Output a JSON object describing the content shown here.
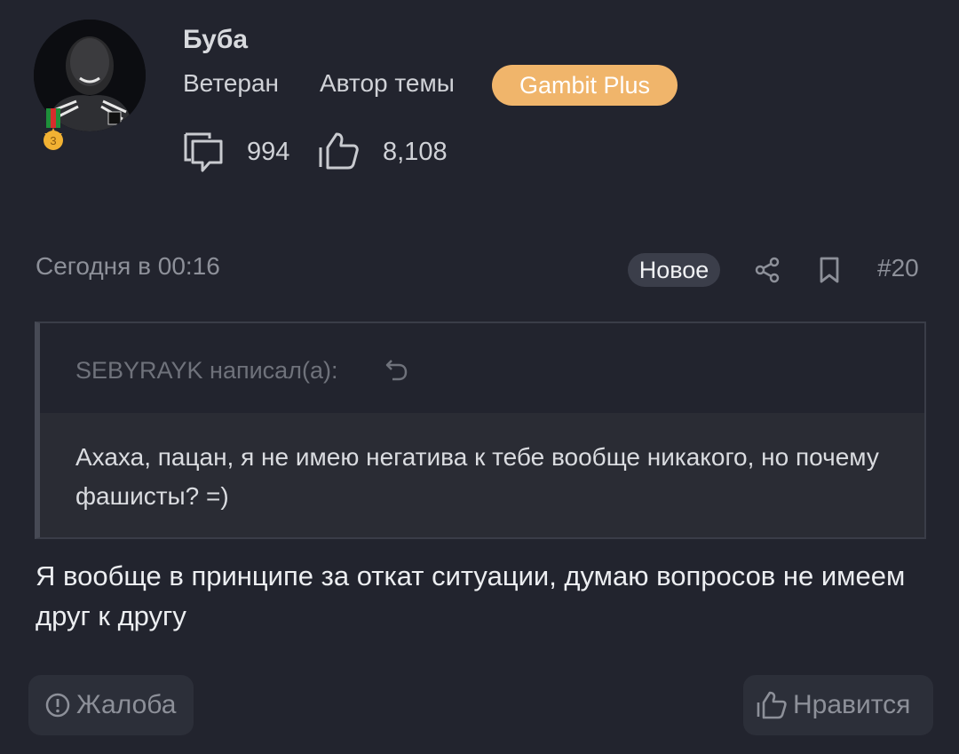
{
  "user": {
    "name": "Буба",
    "rank": "Ветеран",
    "role": "Автор темы",
    "plan_badge": "Gambit Plus",
    "medal_level": "3",
    "messages_count": "994",
    "likes_count": "8,108"
  },
  "post": {
    "date": "Сегодня в 00:16",
    "new_badge": "Новое",
    "number": "#20",
    "quote": {
      "author_line": "SEBYRAYK написал(а):",
      "text": "Ахаха, пацан, я не имею негатива к тебе вообще никакого, но почему фашисты? =)"
    },
    "text": "Я вообще в принципе за откат ситуации, думаю вопросов не имеем друг к другу"
  },
  "actions": {
    "complaint_label": "Жалоба",
    "like_label": "Нравится"
  },
  "colors": {
    "background": "#22242e",
    "plan_badge": "#f0b56b",
    "muted_text": "#8d9099"
  },
  "icons": [
    "messages-icon",
    "thumbs-up-icon",
    "share-icon",
    "bookmark-icon",
    "reply-arrow-icon",
    "alert-circle-icon",
    "medal-icon"
  ]
}
